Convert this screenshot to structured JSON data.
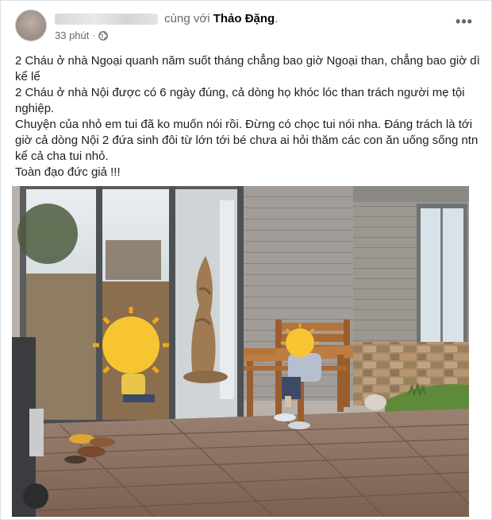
{
  "post": {
    "author_name": "Đặng Thị T...",
    "with_text": "cùng với",
    "tagged_name": "Thảo Đặng",
    "tagged_suffix": ".",
    "time": "33 phút",
    "separator": "·",
    "privacy_icon": "globe-icon",
    "more_icon": "more-horizontal-icon",
    "more_label": "•••",
    "paragraphs": [
      "2 Cháu ở nhà Ngoại quanh năm suốt tháng chẳng bao giờ Ngoại than, chẳng bao giờ dì kể lể",
      "2 Cháu ở nhà Nội được có 6 ngày đúng, cả dòng họ khóc lóc than trách người mẹ tội nghiệp.",
      "Chuyện của nhỏ em tui đã ko muốn nói rồi. Đừng có chọc tui nói nha. Đáng trách là tới giờ cả dòng Nội 2 đứa sinh đôi từ lớn tới bé chưa ai hỏi thăm các con ăn uống sống ntn kể cả cha tui nhỏ.",
      "Toàn đạo đức giả !!!"
    ]
  },
  "photo": {
    "description_icons": [
      "sun-sticker-icon",
      "sun-sticker-icon"
    ],
    "colors": {
      "wall": "#9c9894",
      "deck": "#8a7060",
      "bench": "#b4743c",
      "sun": "#f7c531",
      "stone": "#b09070",
      "grass": "#5f8a3a"
    }
  }
}
